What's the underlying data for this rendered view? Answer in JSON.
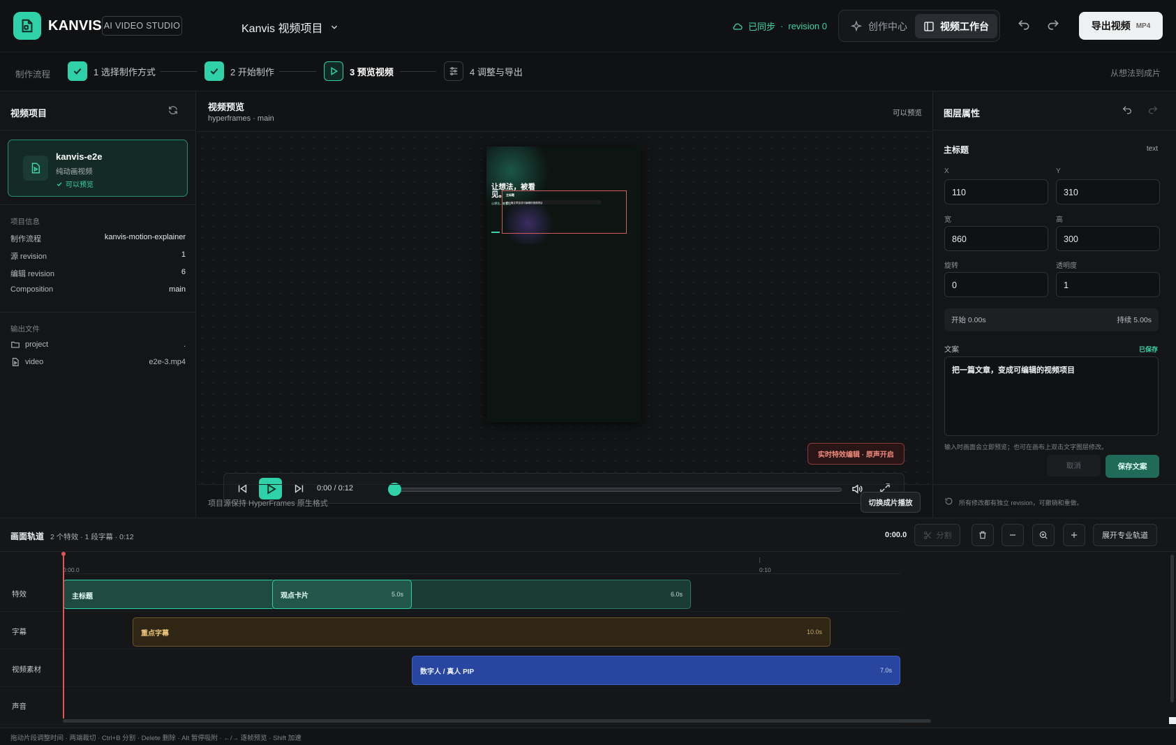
{
  "header": {
    "brand": "KANVIS",
    "studio_badge": "AI VIDEO STUDIO",
    "project_name": "Kanvis 视频项目",
    "sync_status": "已同步",
    "sync_revision": "revision 0",
    "mode_create": "创作中心",
    "mode_studio": "视频工作台",
    "export_label": "导出视频",
    "export_format": "MP4"
  },
  "steps": {
    "label": "制作流程",
    "items": [
      {
        "label": "1 选择制作方式",
        "state": "done"
      },
      {
        "label": "2 开始制作",
        "state": "done"
      },
      {
        "label": "3 预览视频",
        "state": "active"
      },
      {
        "label": "4 调整与导出",
        "state": "pending"
      }
    ],
    "tagline": "从想法到成片"
  },
  "left": {
    "title": "视频项目",
    "project": {
      "name": "kanvis-e2e",
      "type": "纯动画视频",
      "status": "可以预览"
    },
    "info_label": "项目信息",
    "info": [
      {
        "k": "制作流程",
        "v": "kanvis-motion-explainer"
      },
      {
        "k": "源 revision",
        "v": "1"
      },
      {
        "k": "编辑 revision",
        "v": "6"
      },
      {
        "k": "Composition",
        "v": "main"
      }
    ],
    "output_label": "输出文件",
    "files": [
      {
        "k": "project",
        "v": "."
      },
      {
        "k": "video",
        "v": "e2e-3.mp4"
      }
    ]
  },
  "preview": {
    "title": "视频预览",
    "subtitle_a": "hyperframes",
    "subtitle_b": "main",
    "status": "可以预览",
    "canvas_title": "让想法，被看见。",
    "canvas_tag": "主标题",
    "canvas_subtitle": "把一篇文章变成可编辑的视频项目",
    "canvas_small": "让想法，被看见",
    "fx_badge": "实时特效编辑 · 原声开启",
    "time": "0:00 / 0:12",
    "progress": 0,
    "footer_text": "项目源保持 HyperFrames 原生格式",
    "switch_label": "切换成片播放"
  },
  "props": {
    "title": "图层属性",
    "layer_name": "主标题",
    "layer_type": "text",
    "x_label": "X",
    "x": "110",
    "y_label": "Y",
    "y": "310",
    "w_label": "宽",
    "w": "860",
    "h_label": "高",
    "h": "300",
    "rot_label": "旋转",
    "rot": "0",
    "opacity_label": "透明度",
    "opacity": "1",
    "start": "开始 0.00s",
    "duration": "持续 5.00s",
    "copy_label": "文案",
    "copy_saved": "已保存",
    "copy_text": "把一篇文章，变成可编辑的视频项目",
    "hint": "输入时画面会立即预览；也可在画布上双击文字图层修改。",
    "cancel": "取消",
    "save": "保存文案",
    "footer_note": "所有修改都有独立 revision，可撤销和重做。"
  },
  "timeline": {
    "title": "画面轨道",
    "summary": "2 个特效 · 1 段字幕 · 0:12",
    "current_time": "0:00.0",
    "split": "分割",
    "expand": "展开专业轨道",
    "ruler_start": "0:00.0",
    "ruler_mark": "0:10",
    "tracks": [
      "特效",
      "字幕",
      "视频素材",
      "声音"
    ],
    "clips": {
      "fx1_name": "主标题",
      "fx1_dur": "6.0s",
      "fx2_name": "观点卡片",
      "fx2_dur": "5.0s",
      "sub_name": "重点字幕",
      "sub_dur": "10.0s",
      "video_name": "数字人 / 真人 PIP",
      "video_dur": "7.0s"
    }
  },
  "status_bar": "拖动片段调整时间 · 两端裁切 · Ctrl+B 分割 · Delete 删除 · Alt 暂停吸附 · ←/→ 逐帧预览 · Shift 加速",
  "colors": {
    "accent": "#2fd1a8",
    "danger": "#e05555",
    "subtitle_clip": "#3a2e17",
    "video_clip": "#2846a0"
  }
}
